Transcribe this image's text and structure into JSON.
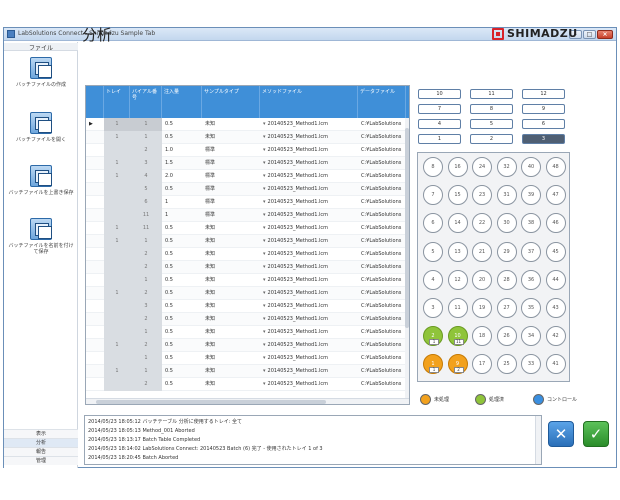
{
  "window": {
    "title": "LabSolutions Connect - Shimadzu Sample Tab"
  },
  "sidebar": {
    "file_label": "ファイル",
    "items": [
      {
        "label": "バッチファイルの作成",
        "icon": "batch-new-icon"
      },
      {
        "label": "バッチファイルを開く",
        "icon": "batch-open-icon"
      },
      {
        "label": "バッチファイルを上書き保存",
        "icon": "batch-save-icon"
      },
      {
        "label": "バッチファイルを名前を付けて保存",
        "icon": "batch-saveas-icon"
      }
    ],
    "bottom": [
      "表示",
      "分析",
      "報告",
      "管理"
    ]
  },
  "page_title": "分析",
  "logo": {
    "text": "SHIMADZU",
    "color": "#d8222a"
  },
  "table": {
    "headers": [
      "トレイ",
      "バイアル番号",
      "注入量",
      "サンプルタイプ",
      "メソッドファイル",
      "データファイル"
    ],
    "rows": [
      {
        "tray": "1",
        "vial": "1",
        "vol": "0.5",
        "type": "未知",
        "method": "20140523_Method1.lcm",
        "data": "C:¥LabSolutions"
      },
      {
        "tray": "1",
        "vial": "1",
        "vol": "0.5",
        "type": "未知",
        "method": "20140523_Method1.lcm",
        "data": "C:¥LabSolutions"
      },
      {
        "tray": "",
        "vial": "2",
        "vol": "1.0",
        "type": "標準",
        "method": "20140523_Method1.lcm",
        "data": "C:¥LabSolutions"
      },
      {
        "tray": "1",
        "vial": "3",
        "vol": "1.5",
        "type": "標準",
        "method": "20140523_Method1.lcm",
        "data": "C:¥LabSolutions"
      },
      {
        "tray": "1",
        "vial": "4",
        "vol": "2.0",
        "type": "標準",
        "method": "20140523_Method1.lcm",
        "data": "C:¥LabSolutions"
      },
      {
        "tray": "",
        "vial": "5",
        "vol": "0.5",
        "type": "標準",
        "method": "20140523_Method1.lcm",
        "data": "C:¥LabSolutions"
      },
      {
        "tray": "",
        "vial": "6",
        "vol": "1",
        "type": "標準",
        "method": "20140523_Method1.lcm",
        "data": "C:¥LabSolutions"
      },
      {
        "tray": "",
        "vial": "11",
        "vol": "1",
        "type": "標準",
        "method": "20140523_Method1.lcm",
        "data": "C:¥LabSolutions"
      },
      {
        "tray": "1",
        "vial": "11",
        "vol": "0.5",
        "type": "未知",
        "method": "20140523_Method1.lcm",
        "data": "C:¥LabSolutions"
      },
      {
        "tray": "1",
        "vial": "1",
        "vol": "0.5",
        "type": "未知",
        "method": "20140523_Method1.lcm",
        "data": "C:¥LabSolutions"
      },
      {
        "tray": "",
        "vial": "2",
        "vol": "0.5",
        "type": "未知",
        "method": "20140523_Method1.lcm",
        "data": "C:¥LabSolutions"
      },
      {
        "tray": "",
        "vial": "2",
        "vol": "0.5",
        "type": "未知",
        "method": "20140523_Method1.lcm",
        "data": "C:¥LabSolutions"
      },
      {
        "tray": "",
        "vial": "1",
        "vol": "0.5",
        "type": "未知",
        "method": "20140523_Method1.lcm",
        "data": "C:¥LabSolutions"
      },
      {
        "tray": "1",
        "vial": "2",
        "vol": "0.5",
        "type": "未知",
        "method": "20140523_Method1.lcm",
        "data": "C:¥LabSolutions"
      },
      {
        "tray": "",
        "vial": "3",
        "vol": "0.5",
        "type": "未知",
        "method": "20140523_Method1.lcm",
        "data": "C:¥LabSolutions"
      },
      {
        "tray": "",
        "vial": "2",
        "vol": "0.5",
        "type": "未知",
        "method": "20140523_Method1.lcm",
        "data": "C:¥LabSolutions"
      },
      {
        "tray": "",
        "vial": "1",
        "vol": "0.5",
        "type": "未知",
        "method": "20140523_Method1.lcm",
        "data": "C:¥LabSolutions"
      },
      {
        "tray": "1",
        "vial": "2",
        "vol": "0.5",
        "type": "未知",
        "method": "20140523_Method1.lcm",
        "data": "C:¥LabSolutions"
      },
      {
        "tray": "",
        "vial": "1",
        "vol": "0.5",
        "type": "未知",
        "method": "20140523_Method1.lcm",
        "data": "C:¥LabSolutions"
      },
      {
        "tray": "1",
        "vial": "1",
        "vol": "0.5",
        "type": "未知",
        "method": "20140523_Method1.lcm",
        "data": "C:¥LabSolutions"
      },
      {
        "tray": "",
        "vial": "2",
        "vol": "0.5",
        "type": "未知",
        "method": "20140523_Method1.lcm",
        "data": "C:¥LabSolutions"
      }
    ]
  },
  "racks": [
    "10",
    "11",
    "12",
    "7",
    "8",
    "9",
    "4",
    "5",
    "6",
    "1",
    "2",
    "3"
  ],
  "selected_rack": "3",
  "plate": {
    "rows": [
      [
        "8",
        "16",
        "24",
        "32",
        "40",
        "48"
      ],
      [
        "7",
        "15",
        "23",
        "31",
        "39",
        "47"
      ],
      [
        "6",
        "14",
        "22",
        "30",
        "38",
        "46"
      ],
      [
        "5",
        "13",
        "21",
        "29",
        "37",
        "45"
      ],
      [
        "4",
        "12",
        "20",
        "28",
        "36",
        "44"
      ],
      [
        "3",
        "11",
        "19",
        "27",
        "35",
        "43"
      ],
      [
        "2",
        "10",
        "18",
        "26",
        "34",
        "42"
      ],
      [
        "1",
        "9",
        "17",
        "25",
        "33",
        "41"
      ]
    ],
    "status": {
      "2": "green",
      "10": "green",
      "1": "orange",
      "9": "orange"
    },
    "mini_labels": {
      "2": "1",
      "10": "11",
      "1": "1",
      "9": "2"
    }
  },
  "legend": [
    {
      "label": "未処理",
      "color": "#f2a11d"
    },
    {
      "label": "処理済",
      "color": "#8fc43a"
    },
    {
      "label": "コントロール",
      "color": "#3a8fe0"
    }
  ],
  "log": [
    "2014/05/23 18:05:12 バッチテーブル 分析に使用するトレイ: 全て",
    "2014/05/23 18:05:13 Method_001 Aborted",
    "2014/05/23 18:13:17 Batch Table Completed",
    "2014/05/23 18:14:02 LabSolutions Connect: 20140523 Batch (6) 完了 - 使用されたトレイ 1 of 3",
    "2014/05/23 18:20:45 Batch Aborted"
  ],
  "actions": {
    "cancel": "✕",
    "ok": "✓"
  }
}
